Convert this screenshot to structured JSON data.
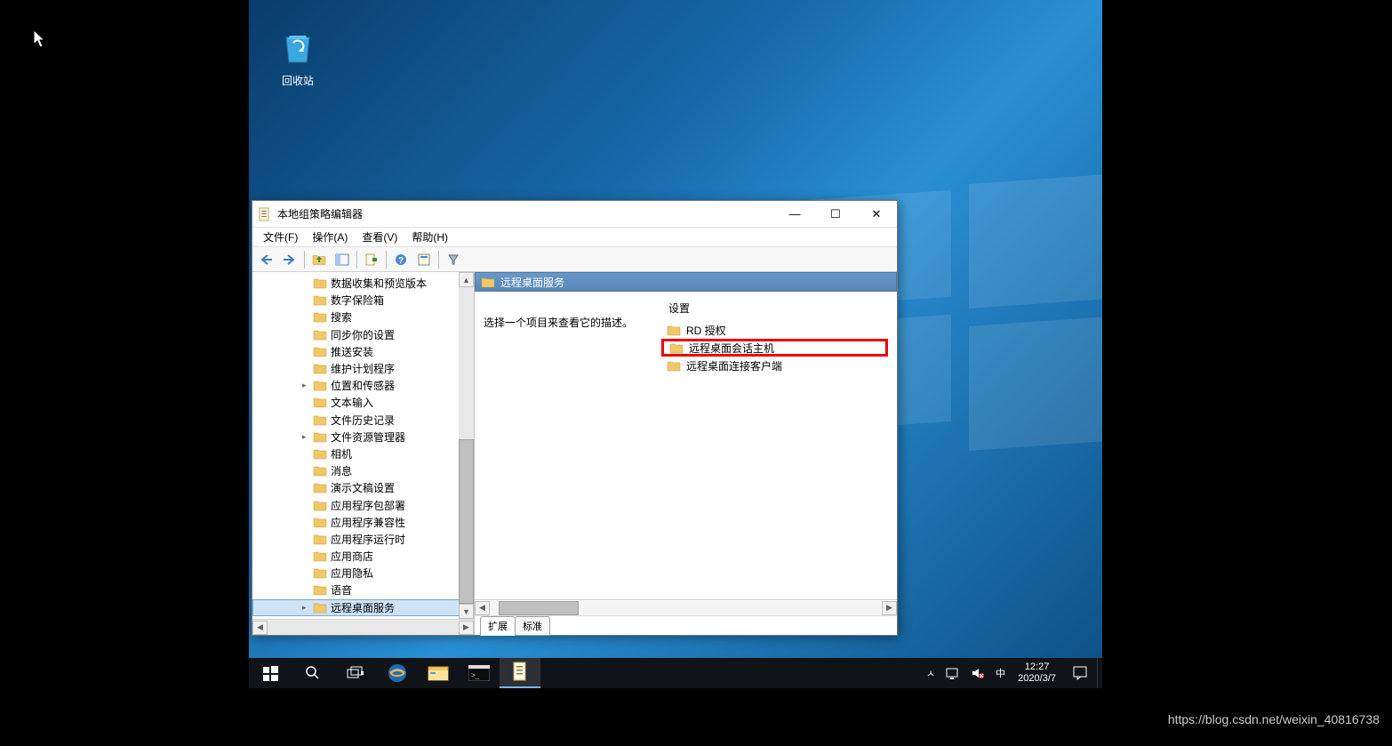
{
  "desktop": {
    "recycle_bin": "回收站"
  },
  "window": {
    "title": "本地组策略编辑器",
    "menu": {
      "file": "文件(F)",
      "action": "操作(A)",
      "view": "查看(V)",
      "help": "帮助(H)"
    },
    "tree": {
      "items": [
        {
          "label": "数据收集和预览版本",
          "exp": false
        },
        {
          "label": "数字保险箱",
          "exp": false
        },
        {
          "label": "搜索",
          "exp": false
        },
        {
          "label": "同步你的设置",
          "exp": false
        },
        {
          "label": "推送安装",
          "exp": false
        },
        {
          "label": "维护计划程序",
          "exp": false
        },
        {
          "label": "位置和传感器",
          "exp": true
        },
        {
          "label": "文本输入",
          "exp": false
        },
        {
          "label": "文件历史记录",
          "exp": false
        },
        {
          "label": "文件资源管理器",
          "exp": true
        },
        {
          "label": "相机",
          "exp": false
        },
        {
          "label": "消息",
          "exp": false
        },
        {
          "label": "演示文稿设置",
          "exp": false
        },
        {
          "label": "应用程序包部署",
          "exp": false
        },
        {
          "label": "应用程序兼容性",
          "exp": false
        },
        {
          "label": "应用程序运行时",
          "exp": false
        },
        {
          "label": "应用商店",
          "exp": false
        },
        {
          "label": "应用隐私",
          "exp": false
        },
        {
          "label": "语音",
          "exp": false
        },
        {
          "label": "远程桌面服务",
          "exp": true,
          "sel": true
        }
      ]
    },
    "detail": {
      "header": "远程桌面服务",
      "hint": "选择一个项目来查看它的描述。",
      "col_setting": "设置",
      "items": [
        {
          "label": "RD 授权",
          "hl": false
        },
        {
          "label": "远程桌面会话主机",
          "hl": true
        },
        {
          "label": "远程桌面连接客户端",
          "hl": false
        }
      ]
    },
    "tabs": {
      "extended": "扩展",
      "standard": "标准"
    }
  },
  "taskbar": {
    "ime": "中",
    "time": "12:27",
    "date": "2020/3/7",
    "chevron": "ㅅ"
  },
  "watermark": "https://blog.csdn.net/weixin_40816738"
}
